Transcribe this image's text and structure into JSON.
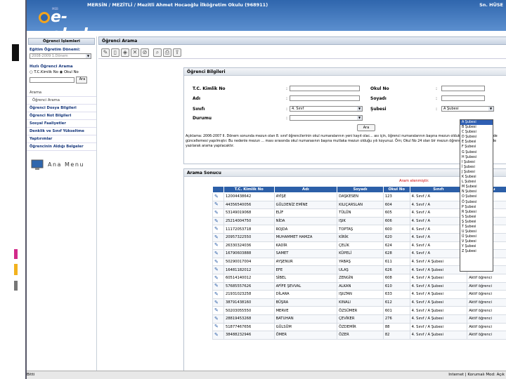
{
  "header": {
    "school": "MERSİN / MEZİTLİ / Mezitli Ahmet Hocaoğlu İlköğretim Okulu (968911)",
    "user": "Sn. HÜSE",
    "logo_text": "e-okul",
    "logo_small": "MEB"
  },
  "sidebar": {
    "header": "Öğrenci İşlemleri",
    "term_label": "Eğitim Öğretim Dönemi:",
    "term_value": "2008-2009 1.Dönem",
    "quick_search": "Hızlı Öğrenci Arama",
    "radio_tc": "T.C.Kimlik No",
    "radio_okul": "Okul No",
    "search_btn": "Ara",
    "menu": [
      {
        "label": "Arama",
        "plain": true
      },
      {
        "label": "Öğrenci Arama",
        "plain": true
      },
      {
        "label": "Öğrenci Dosya Bilgileri"
      },
      {
        "label": "Öğrenci Not Bilgileri"
      },
      {
        "label": "Sosyal Faaliyetler"
      },
      {
        "label": "Denklik ve Sınıf Yükseltme"
      },
      {
        "label": "Yaptırımlar"
      },
      {
        "label": "Öğrencinin Aldığı Belgeler"
      }
    ],
    "ana_menu": "Ana Menu"
  },
  "main": {
    "title": "Öğrenci Arama"
  },
  "form": {
    "title": "Öğrenci Bilgileri",
    "tc_label": "T.C. Kimlik No",
    "ad_label": "Adı",
    "sinif_label": "Sınıfı",
    "durum_label": "Durumu",
    "okulno_label": "Okul No",
    "soyad_label": "Soyadı",
    "sube_label": "Şubesi",
    "sinif_value": "4. Sınıf",
    "sube_value": "A Şubesi",
    "ara_btn": "Ara",
    "note": "Açıklama: 2006-2007 II. Dönem sonunda mezun olan 8. sınıf öğrencilerinin okul numaralarının yeni kayıt olac... ası için, öğrenci numaralarının başına mezun oldukları yıl gelecek şekilde güncellemesi yapılmıştır. Bu nedenle mezun ... ması sırasında okul numarasının başına mutlaka mezun olduğu yılı koyunuz. Örn; Okul No 24 olan bir mezun öğrenc... a 200724 şeklinde yazılarak arama yapılacaktır."
  },
  "dropdown": [
    "A Şubesi",
    "B Şubesi",
    "C Şubesi",
    "D Şubesi",
    "E Şubesi",
    "F Şubesi",
    "G Şubesi",
    "H Şubesi",
    "I Şubesi",
    "İ Şubesi",
    "J Şubesi",
    "K Şubesi",
    "L Şubesi",
    "M Şubesi",
    "N Şubesi",
    "O Şubesi",
    "Ö Şubesi",
    "P Şubesi",
    "R Şubesi",
    "S Şubesi",
    "Ş Şubesi",
    "T Şubesi",
    "U Şubesi",
    "Ü Şubesi",
    "V Şubesi",
    "Y Şubesi",
    "Z Şubesi"
  ],
  "results": {
    "title": "Arama Sonucu",
    "message": "Aram                                                          elenmiştir.",
    "columns": [
      "T.C. Kimlik No",
      "Adı",
      "Soyadı",
      "Okul No",
      "Sınıfı",
      "Durumu"
    ],
    "rows": [
      [
        "12004438642",
        "AYİŞE",
        "DAŞKESEN",
        "123",
        "4. Sınıf / A",
        "Aktif öğrenci"
      ],
      [
        "44356540056",
        "GÜLDENİZ EMİNE",
        "KILIÇARSLAN",
        "604",
        "4. Sınıf / A",
        "Aktif öğrenci"
      ],
      [
        "53149019068",
        "ELİF",
        "TÜLÜN",
        "605",
        "4. Sınıf / A",
        "Aktif öğrenci"
      ],
      [
        "25214004750",
        "NİDA",
        "IŞIK",
        "606",
        "4. Sınıf / A",
        "Aktif öğrenci"
      ],
      [
        "11172053718",
        "ROJDA",
        "TOPTAŞ",
        "600",
        "4. Sınıf / A",
        "Aktif öğrenci"
      ],
      [
        "20957322550",
        "MUHAMMET HAMZA",
        "KİRİK",
        "620",
        "4. Sınıf / A",
        "Aktif öğrenci"
      ],
      [
        "26330324036",
        "KADİR",
        "ÇELİK",
        "624",
        "4. Sınıf / A",
        "Aktif öğrenci"
      ],
      [
        "16790603888",
        "SAMET",
        "KÜPELİ",
        "628",
        "4. Sınıf / A",
        "Aktif öğrenci"
      ],
      [
        "50290017004",
        "AYŞENUR",
        "YABAŞ",
        "611",
        "4. Sınıf / A Şubesi",
        "Aktif öğrenci"
      ],
      [
        "16481182012",
        "EFE",
        "ULAŞ",
        "626",
        "4. Sınıf / A Şubesi",
        "Aktif öğrenci"
      ],
      [
        "60514140012",
        "SİBEL",
        "ZENGİN",
        "608",
        "4. Sınıf / A Şubesi",
        "Aktif öğrenci"
      ],
      [
        "57685557626",
        "AFİFE ŞEVVAL",
        "ALKAN",
        "610",
        "4. Sınıf / A Şubesi",
        "Aktif öğrenci"
      ],
      [
        "21931023258",
        "DİLARA",
        "IŞILTAN",
        "633",
        "4. Sınıf / A Şubesi",
        "Aktif öğrenci"
      ],
      [
        "38791438160",
        "BÜŞRA",
        "KINALI",
        "612",
        "4. Sınıf / A Şubesi",
        "Aktif öğrenci"
      ],
      [
        "50203055550",
        "MERVE",
        "ÖZSÜMER",
        "601",
        "4. Sınıf / A Şubesi",
        "Aktif öğrenci"
      ],
      [
        "28819453268",
        "BATUHAN",
        "ÇEVİKER",
        "276",
        "4. Sınıf / A Şubesi",
        "Aktif öğrenci"
      ],
      [
        "51877467656",
        "GÜLSÜM",
        "ÖZDEMİR",
        "88",
        "4. Sınıf / A Şubesi",
        "Aktif öğrenci"
      ],
      [
        "38488232946",
        "ÖMER",
        "ÖZER",
        "82",
        "4. Sınıf / A Şubesi",
        "Aktif öğrenci"
      ]
    ]
  },
  "status": {
    "left": "Bitti",
    "right": "Internet | Korumalı Mod: Açık"
  }
}
